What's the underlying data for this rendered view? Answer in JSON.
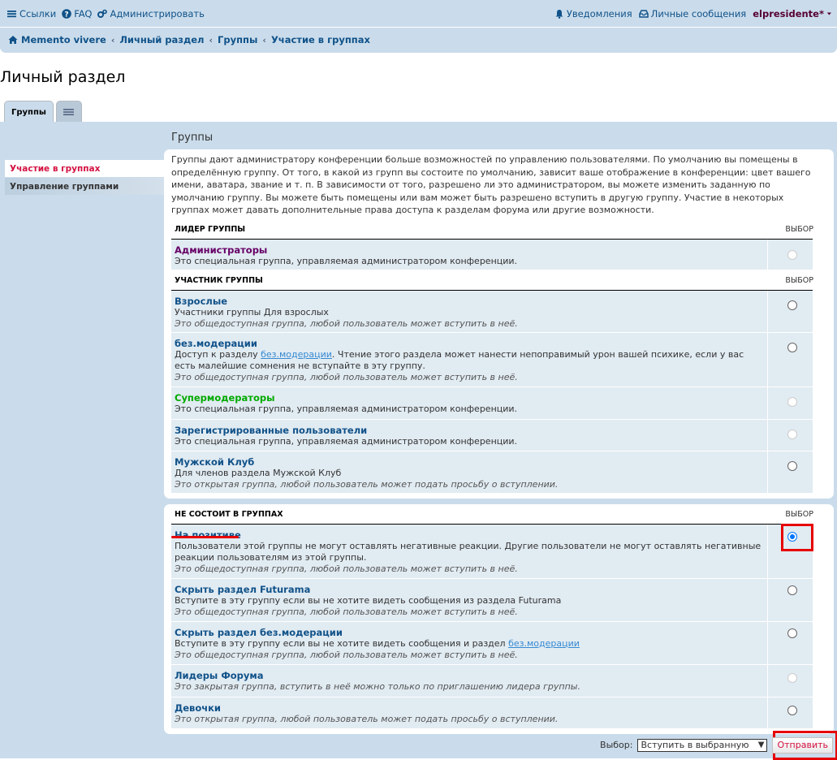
{
  "nav": {
    "links": {
      "links": "Ссылки",
      "faq": "FAQ",
      "admin": "Администрировать"
    },
    "notifications": "Уведомления",
    "messages": "Личные сообщения",
    "username": "elpresidente*"
  },
  "breadcrumbs": [
    "Memento vivere",
    "Личный раздел",
    "Группы",
    "Участие в группах"
  ],
  "page_title": "Личный раздел",
  "tabs": {
    "groups": "Группы"
  },
  "side_menu": {
    "membership": "Участие в группах",
    "manage": "Управление группами"
  },
  "section_title": "Группы",
  "intro": "Группы дают администратору конференции больше возможностей по управлению пользователями. По умолчанию вы помещены в определённую группу. От того, в какой из групп вы состоите по умолчанию, зависит ваше отображение в конференции: цвет вашего имени, аватара, звание и т. п. В зависимости от того, разрешено ли это администратором, вы можете изменить заданную по умолчанию группу. Вы можете быть помещены или вам может быть разрешено вступить в другую группу. Участие в некоторых группах может давать дополнительные права доступа к разделам форума или другие возможности.",
  "select_col": "ВЫБОР",
  "leader_header": "ЛИДЕР ГРУППЫ",
  "leader_groups": [
    {
      "name": "Администраторы",
      "color": "#660066",
      "desc": "Это специальная группа, управляемая администратором конференции.",
      "note": ""
    }
  ],
  "member_header": "УЧАСТНИК ГРУППЫ",
  "member_groups": [
    {
      "name": "Взрослые",
      "color": "#105289",
      "desc": "Участники группы Для взрослых",
      "note": "Это общедоступная группа, любой пользователь может вступить в неё."
    },
    {
      "name": "без.модерации",
      "color": "#105289",
      "desc_pre": "Доступ к разделу ",
      "desc_link": "без.модерации",
      "desc_post": ". Чтение этого раздела может нанести непоправимый урон вашей психике, если у вас есть малейшие сомнения не вступайте в эту группу.",
      "note": "Это общедоступная группа, любой пользователь может вступить в неё."
    },
    {
      "name": "Супермодераторы",
      "color": "#00AA00",
      "desc": "Это специальная группа, управляемая администратором конференции.",
      "note": ""
    },
    {
      "name": "Зарегистрированные пользователи",
      "color": "#105289",
      "desc": "Это специальная группа, управляемая администратором конференции.",
      "note": ""
    },
    {
      "name": "Мужской Клуб",
      "color": "#105289",
      "desc": "Для членов раздела Мужской Клуб",
      "note": "Это открытая группа, любой пользователь может подать просьбу о вступлении."
    }
  ],
  "nonmember_header": "НЕ СОСТОИТ В ГРУППАХ",
  "nonmember_groups": [
    {
      "name": "На позитиве",
      "color": "#105289",
      "desc": "Пользователи этой группы не могут оставлять негативные реакции. Другие пользователи не могут оставлять негативные реакции пользователям из этой группы.",
      "note": "Это общедоступная группа, любой пользователь может вступить в неё.",
      "checked": true
    },
    {
      "name": "Скрыть раздел Futurama",
      "color": "#105289",
      "desc": "Вступите в эту группу если вы не хотите видеть сообщения из раздела Futurama",
      "note": "Это общедоступная группа, любой пользователь может вступить в неё."
    },
    {
      "name": "Скрыть раздел без.модерации",
      "color": "#105289",
      "desc_pre": "Вступите в эту группу если вы не хотите видеть сообщения и раздел ",
      "desc_link": "без.модерации",
      "desc_post": "",
      "note": "Это общедоступная группа, любой пользователь может вступить в неё."
    },
    {
      "name": "Лидеры Форума",
      "color": "#105289",
      "desc": "",
      "note": "Это закрытая группа, вступить в неё можно только по приглашению лидера группы."
    },
    {
      "name": "Девочки",
      "color": "#105289",
      "desc": "",
      "note": "Это открытая группа, любой пользователь может подать просьбу о вступлении."
    }
  ],
  "footer": {
    "select_label": "Выбор:",
    "select_value": "Вступить в выбранную",
    "submit": "Отправить"
  },
  "colors": {
    "accent": "#105289",
    "panel_bg": "#cadceb",
    "row_bg": "#e1ebf2",
    "highlight": "#e60000"
  }
}
